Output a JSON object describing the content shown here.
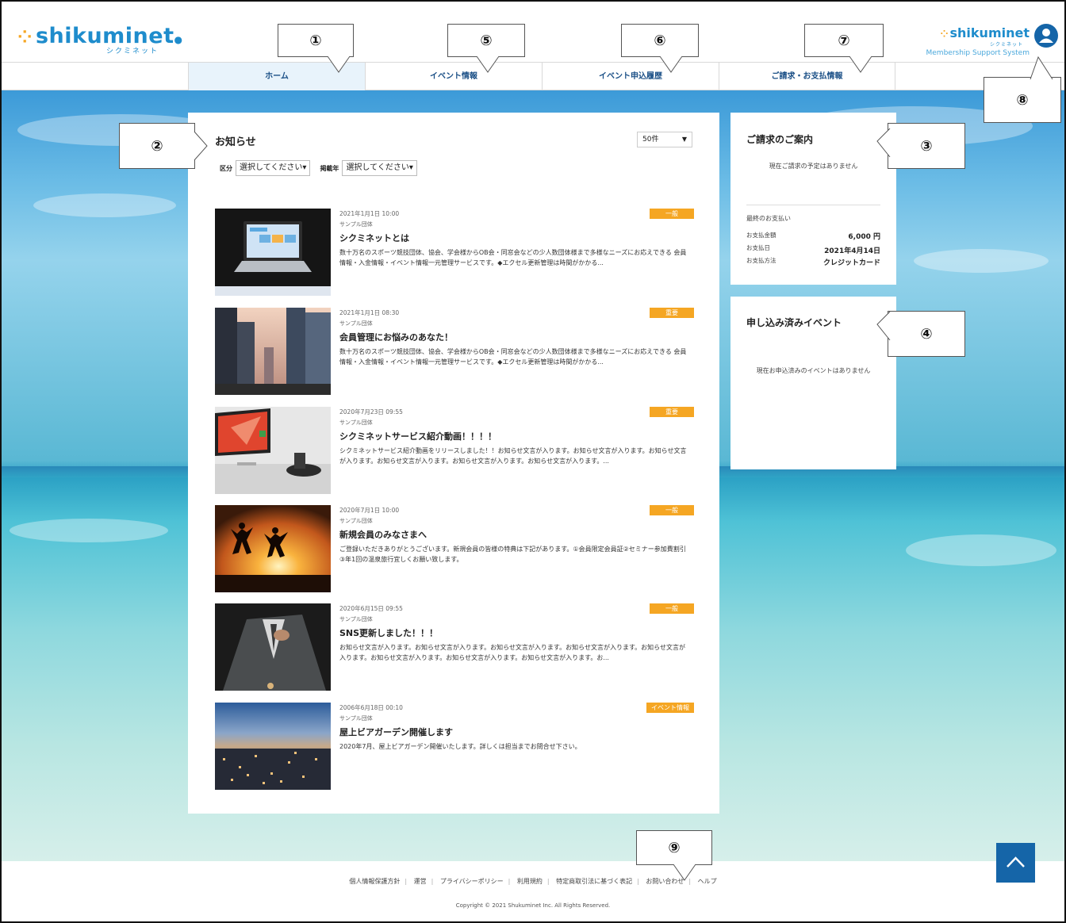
{
  "header": {
    "logo_text": "shikuminet",
    "logo_kana": "シクミネット",
    "logo2_text": "shikuminet",
    "logo2_kana": "シクミネット",
    "logo2_sub": "Membership Support System"
  },
  "nav": {
    "items": [
      {
        "label": "ホーム"
      },
      {
        "label": "イベント情報"
      },
      {
        "label": "イベント申込履歴"
      },
      {
        "label": "ご請求・お支払情報"
      }
    ]
  },
  "notice": {
    "title": "お知らせ",
    "count_select": "50件",
    "filter1_label": "区分",
    "filter1_value": "選択してください",
    "filter2_label": "掲載年",
    "filter2_value": "選択してください",
    "items": [
      {
        "date": "2021年1月1日 10:00",
        "org": "サンプル団体",
        "title": "シクミネットとは",
        "badge": "一般",
        "body": "数十万名のスポーツ競技団体、協会、学会様からOB会・同窓会などの少人数団体様まで多様なニーズにお応えできる 会員情報・入金情報・イベント情報一元管理サービスです。◆エクセル更新管理は時間がかかる..."
      },
      {
        "date": "2021年1月1日 08:30",
        "org": "サンプル団体",
        "title": "会員管理にお悩みのあなた！",
        "badge": "重要",
        "body": "数十万名のスポーツ競技団体、協会、学会様からOB会・同窓会などの少人数団体様まで多様なニーズにお応えできる 会員情報・入金情報・イベント情報一元管理サービスです。◆エクセル更新管理は時間がかかる..."
      },
      {
        "date": "2020年7月23日 09:55",
        "org": "サンプル団体",
        "title": "シクミネットサービス紹介動画！！！！",
        "badge": "重要",
        "body": "シクミネットサービス紹介動画をリリースしました！！お知らせ文言が入ります。お知らせ文言が入ります。お知らせ文言が入ります。お知らせ文言が入ります。お知らせ文言が入ります。お知らせ文言が入ります。..."
      },
      {
        "date": "2020年7月1日 10:00",
        "org": "サンプル団体",
        "title": "新規会員のみなさまへ",
        "badge": "一般",
        "body": "ご登録いただきありがとうございます。新規会員の皆様の特典は下記があります。①会員限定会員証②セミナー参加費割引③年1回の温泉旅行宜しくお願い致します。"
      },
      {
        "date": "2020年6月15日 09:55",
        "org": "サンプル団体",
        "title": "SNS更新しました！！！",
        "badge": "一般",
        "body": "お知らせ文言が入ります。お知らせ文言が入ります。お知らせ文言が入ります。お知らせ文言が入ります。お知らせ文言が入ります。お知らせ文言が入ります。お知らせ文言が入ります。お知らせ文言が入ります。お..."
      },
      {
        "date": "2006年6月18日 00:10",
        "org": "サンプル団体",
        "title": "屋上ビアガーデン開催します",
        "badge": "イベント情報",
        "body": "2020年7月、屋上ビアガーデン開催いたします。詳しくは担当までお問合せ下さい。"
      }
    ]
  },
  "billing": {
    "title": "ご請求のご案内",
    "message": "現在ご請求の予定はありません",
    "last_payment_label": "最終のお支払い",
    "amount_label": "お支払金額",
    "amount_value": "6,000 円",
    "date_label": "お支払日",
    "date_value": "2021年4月14日",
    "method_label": "お支払方法",
    "method_value": "クレジットカード"
  },
  "events": {
    "title": "申し込み済みイベント",
    "message": "現在お申込済みのイベントはありません"
  },
  "footer": {
    "links": [
      "個人情報保護方針",
      "運営",
      "プライバシーポリシー",
      "利用規約",
      "特定商取引法に基づく表記",
      "お問い合わせ",
      "ヘルプ"
    ],
    "copyright": "Copyright © 2021 Shukuminet Inc. All Rights Reserved."
  },
  "callouts": [
    "①",
    "②",
    "③",
    "④",
    "⑤",
    "⑥",
    "⑦",
    "⑧",
    "⑨"
  ],
  "colors": {
    "brand": "#1e8ccc",
    "accent": "#f5a623",
    "nav_active": "#e8f3fb",
    "dark_blue": "#1565a8"
  }
}
